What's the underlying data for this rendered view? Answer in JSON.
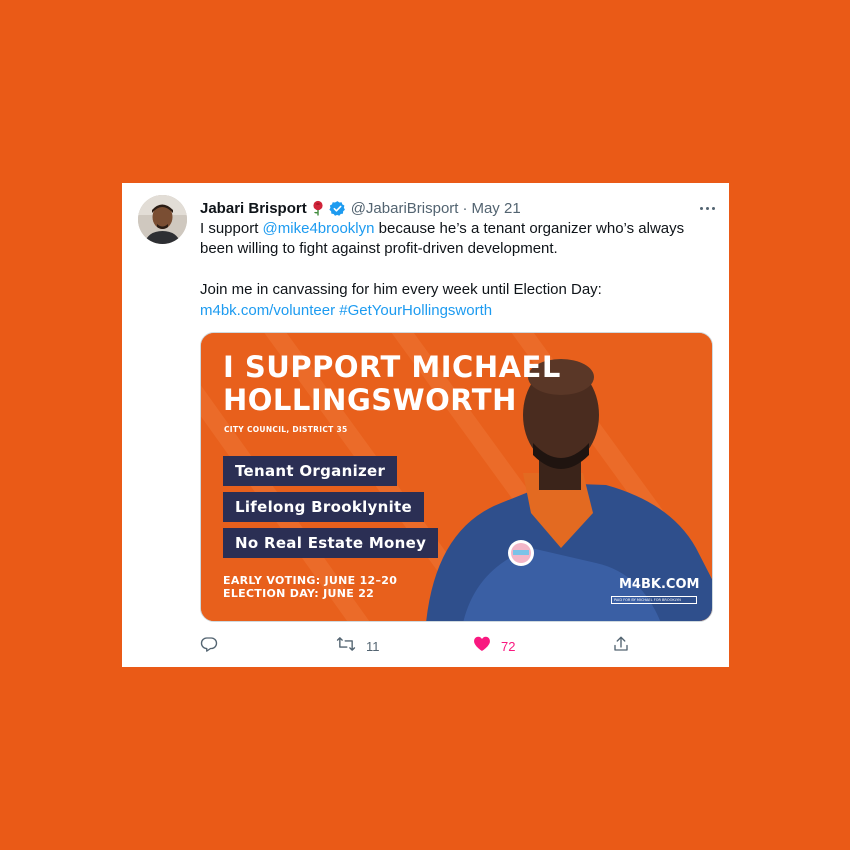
{
  "tweet": {
    "author_name": "Jabari Brisport",
    "handle": "@JabariBrisport",
    "separator": "·",
    "date": "May 21",
    "line1_prefix": "I support ",
    "line1_mention": "@mike4brooklyn",
    "line1_suffix": " because he’s a tenant organizer who’s always been willing to fight against profit-driven development.",
    "line2": "Join me in canvassing for him every week until Election Day:",
    "link_url": "m4bk.com/volunteer",
    "link_space": " ",
    "link_hashtag": "#GetYourHollingsworth"
  },
  "media": {
    "headline_line1": "I SUPPORT MICHAEL",
    "headline_line2": "HOLLINGSWORTH",
    "subtitle": "CITY COUNCIL, DISTRICT 35",
    "pills": [
      "Tenant Organizer",
      "Lifelong Brooklynite",
      "No Real Estate Money"
    ],
    "early_voting": "EARLY VOTING: JUNE 12–20",
    "election_day": "ELECTION DAY: JUNE 22",
    "site": "M4BK.COM",
    "paid_for": "PAID FOR BY MICHAEL FOR BROOKLYN"
  },
  "actions": {
    "retweet_count": "11",
    "like_count": "72"
  },
  "colors": {
    "background": "#ea5a17",
    "link": "#1d9bf0",
    "verified": "#1d9bf0",
    "like": "#f91880",
    "pill": "#2b2f54"
  },
  "icons": [
    "rose-emoji-icon",
    "verified-badge-icon",
    "more-icon",
    "reply-icon",
    "retweet-icon",
    "like-heart-icon",
    "share-icon"
  ]
}
